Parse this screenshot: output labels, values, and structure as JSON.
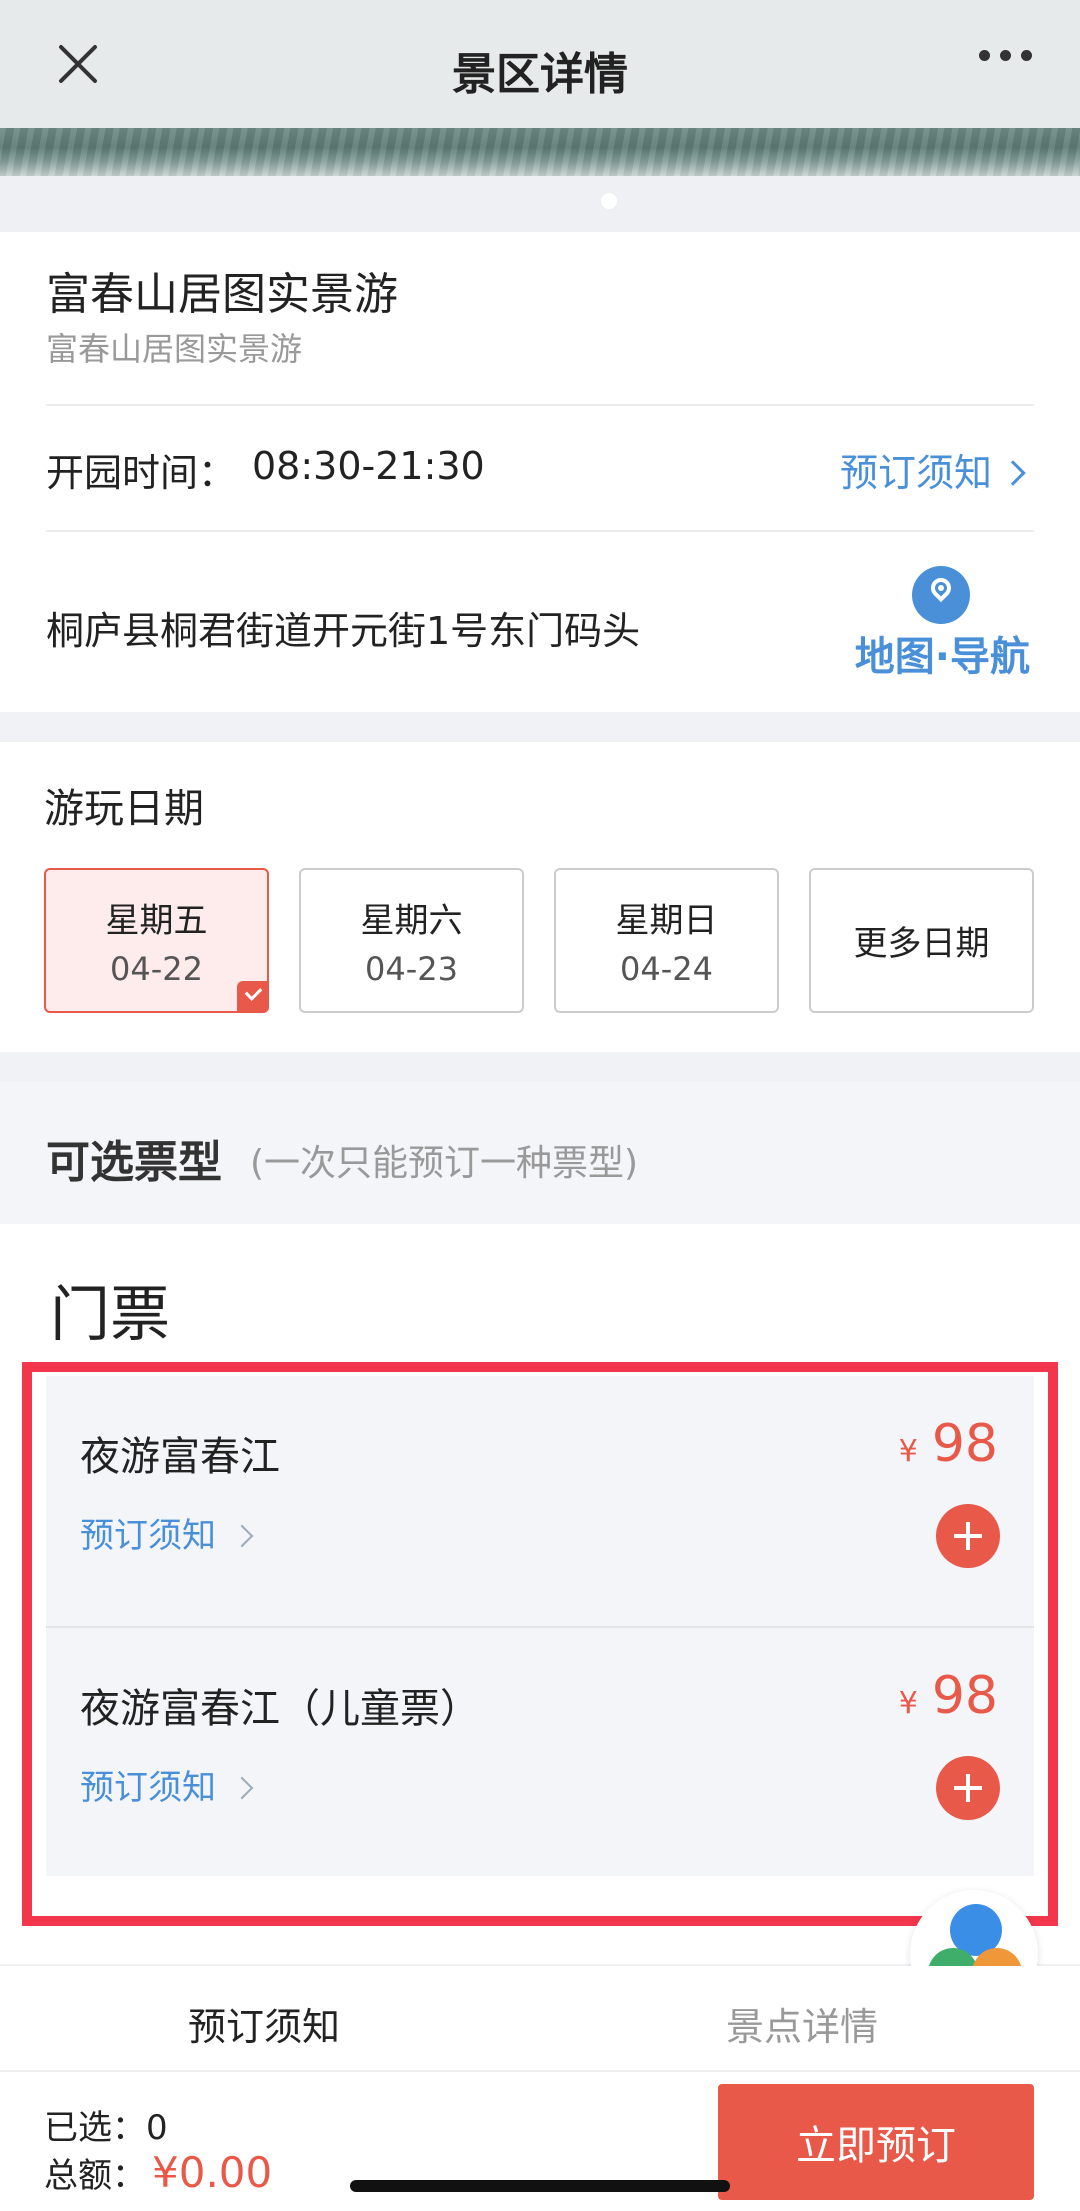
{
  "header": {
    "title": "景区详情"
  },
  "spot": {
    "name": "富春山居图实景游",
    "subtitle": "富春山居图实景游",
    "hours_label": "开园时间：",
    "hours_value": "08:30-21:30",
    "notice_link": "预订须知",
    "address": "桐庐县桐君街道开元街1号东门码头",
    "map_label": "地图·导航"
  },
  "dates": {
    "title": "游玩日期",
    "items": [
      {
        "day": "星期五",
        "date": "04-22",
        "selected": true
      },
      {
        "day": "星期六",
        "date": "04-23",
        "selected": false
      },
      {
        "day": "星期日",
        "date": "04-24",
        "selected": false
      }
    ],
    "more_label": "更多日期"
  },
  "ticket_types": {
    "title": "可选票型",
    "note": "(一次只能预订一种票型)",
    "section_heading": "门票",
    "items": [
      {
        "name": "夜游富春江",
        "notice": "预订须知",
        "currency": "¥",
        "price": "98"
      },
      {
        "name": "夜游富春江（儿童票）",
        "notice": "预订须知",
        "currency": "¥",
        "price": "98"
      }
    ]
  },
  "tabs": {
    "notice": "预订须知",
    "detail": "景点详情"
  },
  "bottom": {
    "selected_label": "已选：",
    "selected_count": "0",
    "total_label": "总额：",
    "total_value": "¥0.00",
    "book_label": "立即预订"
  },
  "colors": {
    "accent": "#e8594a",
    "link": "#4a90d9",
    "highlight": "#f2364b"
  },
  "icons": [
    "close-icon",
    "more-icon",
    "chevron-right-icon",
    "map-pin-icon",
    "check-icon",
    "plus-icon",
    "service-widget-icon"
  ]
}
